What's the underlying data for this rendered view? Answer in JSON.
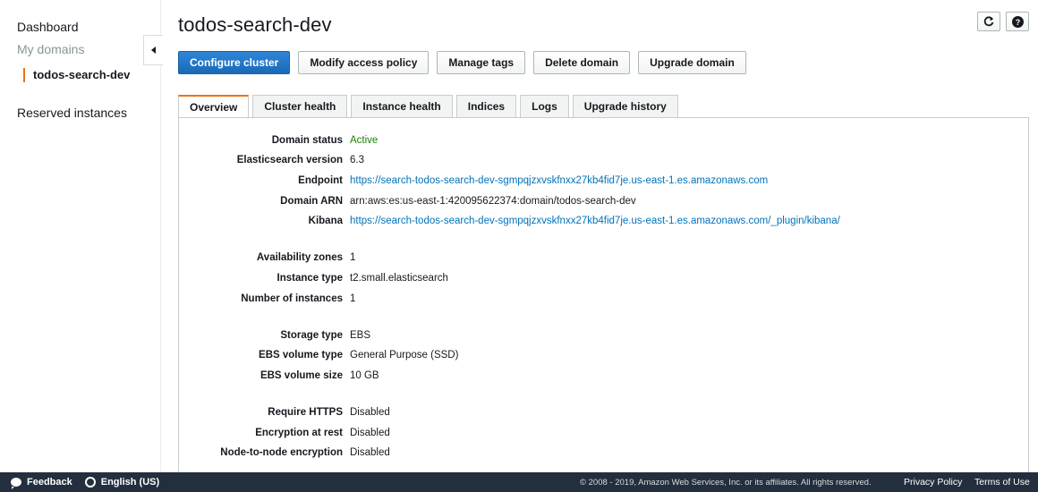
{
  "sidebar": {
    "dashboard": "Dashboard",
    "my_domains": "My domains",
    "current_domain": "todos-search-dev",
    "reserved": "Reserved instances"
  },
  "header": {
    "title": "todos-search-dev",
    "refresh_icon": "refresh-icon",
    "help_icon": "help-icon",
    "help_glyph": "?"
  },
  "toolbar": {
    "configure": "Configure cluster",
    "modify_access": "Modify access policy",
    "manage_tags": "Manage tags",
    "delete": "Delete domain",
    "upgrade": "Upgrade domain"
  },
  "tabs": [
    {
      "label": "Overview"
    },
    {
      "label": "Cluster health"
    },
    {
      "label": "Instance health"
    },
    {
      "label": "Indices"
    },
    {
      "label": "Logs"
    },
    {
      "label": "Upgrade history"
    }
  ],
  "details": [
    {
      "label": "Domain status",
      "value": "Active"
    },
    {
      "label": "Elasticsearch version",
      "value": "6.3"
    },
    {
      "label": "Endpoint",
      "value": "https://search-todos-search-dev-sgmpqjzxvskfnxx27kb4fid7je.us-east-1.es.amazonaws.com"
    },
    {
      "label": "Domain ARN",
      "value": "arn:aws:es:us-east-1:420095622374:domain/todos-search-dev"
    },
    {
      "label": "Kibana",
      "value": "https://search-todos-search-dev-sgmpqjzxvskfnxx27kb4fid7je.us-east-1.es.amazonaws.com/_plugin/kibana/"
    },
    {
      "label": "Availability zones",
      "value": "1"
    },
    {
      "label": "Instance type",
      "value": "t2.small.elasticsearch"
    },
    {
      "label": "Number of instances",
      "value": "1"
    },
    {
      "label": "Storage type",
      "value": "EBS"
    },
    {
      "label": "EBS volume type",
      "value": "General Purpose (SSD)"
    },
    {
      "label": "EBS volume size",
      "value": "10 GB"
    },
    {
      "label": "Require HTTPS",
      "value": "Disabled"
    },
    {
      "label": "Encryption at rest",
      "value": "Disabled"
    },
    {
      "label": "Node-to-node encryption",
      "value": "Disabled"
    }
  ],
  "footer": {
    "feedback": "Feedback",
    "language": "English (US)",
    "copyright": "© 2008 - 2019, Amazon Web Services, Inc. or its affiliates. All rights reserved.",
    "privacy": "Privacy Policy",
    "terms": "Terms of Use"
  },
  "colors": {
    "accent": "#ec7211",
    "primary_button": "#1a69b8",
    "link": "#0073bb",
    "status_active": "#1d8102",
    "footer_bg": "#232f3e"
  }
}
